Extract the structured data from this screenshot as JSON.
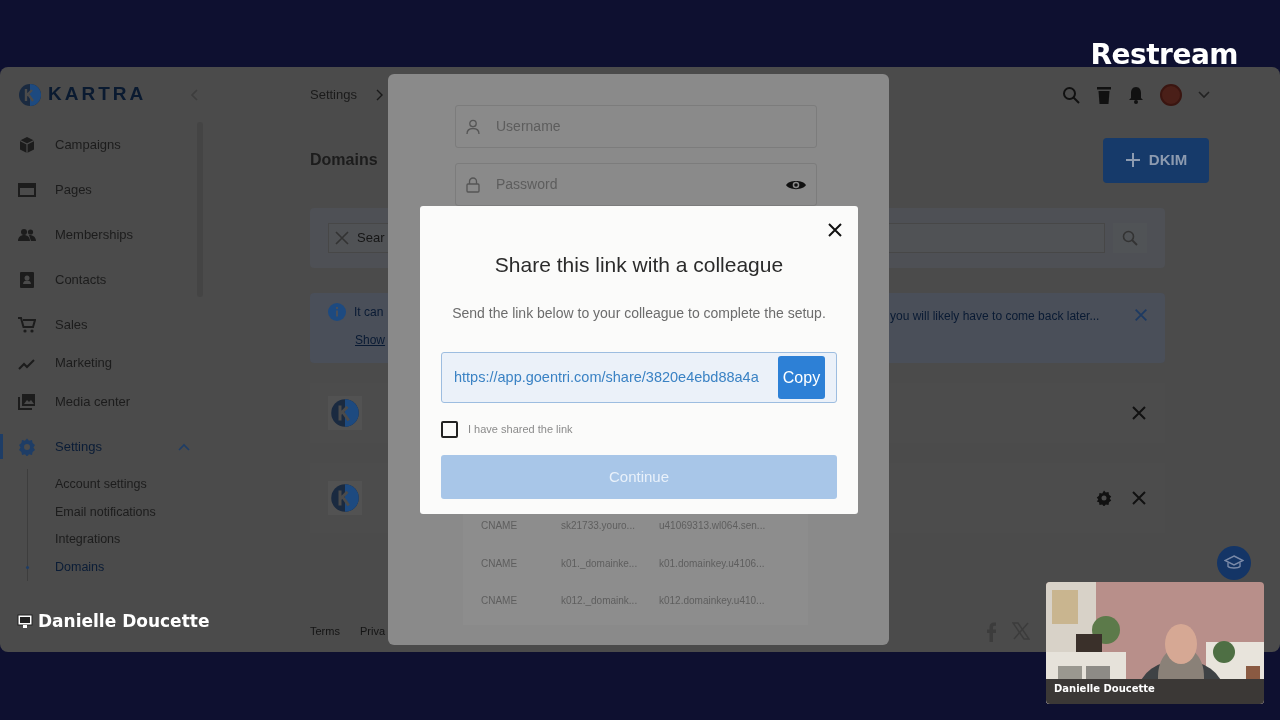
{
  "stream": {
    "brand": "Restream",
    "presenter_label": "Danielle Doucette",
    "camera": {
      "kind": "picture",
      "caption": "Danielle Doucette"
    }
  },
  "app": {
    "logo": "KARTRA",
    "sidebar": {
      "items": [
        {
          "label": "Campaigns",
          "selected": false
        },
        {
          "label": "Pages",
          "selected": false
        },
        {
          "label": "Memberships",
          "selected": false
        },
        {
          "label": "Contacts",
          "selected": false
        },
        {
          "label": "Sales",
          "selected": false
        },
        {
          "label": "Marketing",
          "selected": false
        },
        {
          "label": "Media center",
          "selected": false
        },
        {
          "label": "Settings",
          "selected": true,
          "expanded": true,
          "children": [
            {
              "label": "Account settings",
              "selected": false
            },
            {
              "label": "Email notifications",
              "selected": false
            },
            {
              "label": "Integrations",
              "selected": false
            },
            {
              "label": "Domains",
              "selected": true
            }
          ]
        }
      ]
    },
    "breadcrumb": [
      "Settings"
    ],
    "title": "Domains",
    "add_button": "DKIM",
    "search": {
      "placeholder": "Sear"
    },
    "alert": {
      "text_start": "It can",
      "text_end": "you will likely have to come back later...",
      "link": "Show"
    },
    "domains": [
      {
        "has_settings": false
      },
      {
        "has_settings": true
      }
    ],
    "footer_links": [
      "Terms",
      "Priva"
    ]
  },
  "login_dialog": {
    "fields": [
      {
        "kind": "text",
        "placeholder": "Username"
      },
      {
        "kind": "password",
        "placeholder": "Password"
      }
    ],
    "records": [
      {
        "type": "CNAME",
        "host": "sk21733.youro...",
        "value": "u41069313.wl064.sen..."
      },
      {
        "type": "CNAME",
        "host": "k01._domainke...",
        "value": "k01.domainkey.u4106..."
      },
      {
        "type": "CNAME",
        "host": "k012._domaink...",
        "value": "k012.domainkey.u410..."
      }
    ]
  },
  "share_dialog": {
    "title": "Share this link with a colleague",
    "description": "Send the link below to your colleague to complete the setup.",
    "link": "https://app.goentri.com/share/3820e4ebd88a4a",
    "copy_button": "Copy",
    "checkbox": {
      "label": "I have shared the link",
      "checked": false
    },
    "continue_button": {
      "label": "Continue",
      "disabled": true
    }
  }
}
